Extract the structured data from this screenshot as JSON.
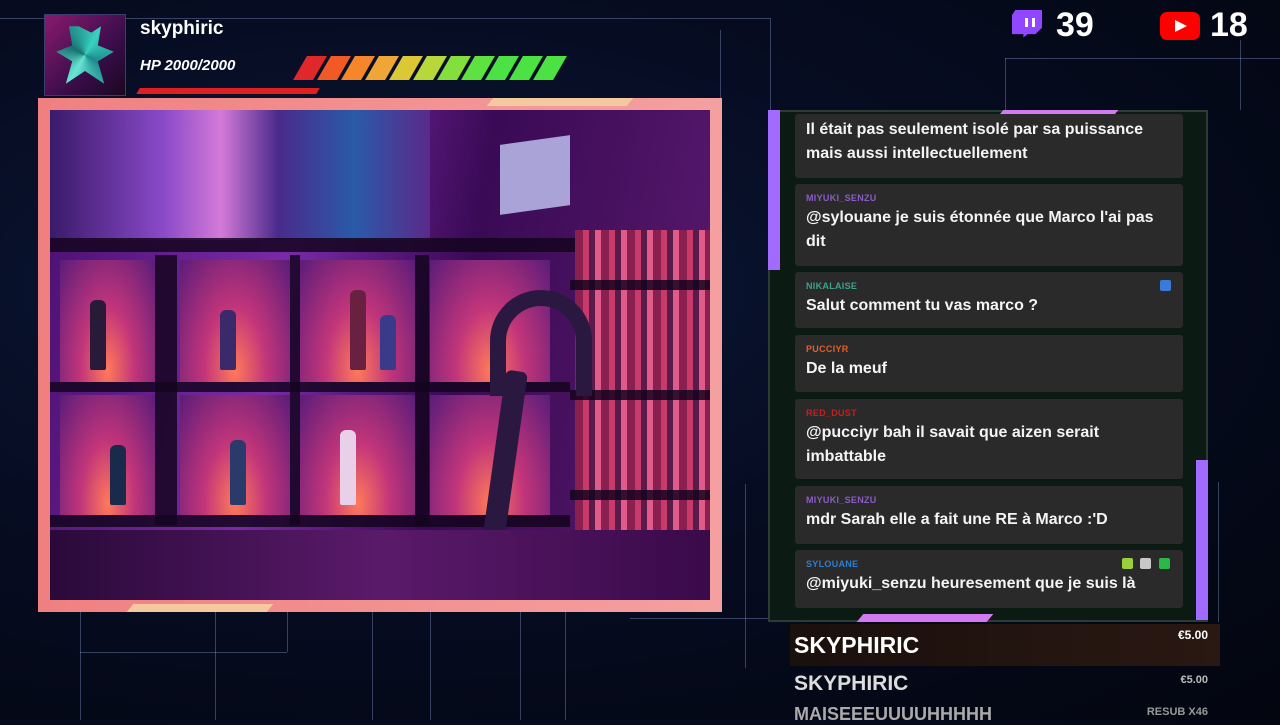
{
  "streamer": {
    "name": "skyphiric",
    "hp": "HP 2000/2000"
  },
  "counters": {
    "twitch": "39",
    "youtube": "18"
  },
  "hp_segments": [
    "#e0272a",
    "#f25a25",
    "#f5862a",
    "#f0a637",
    "#dcc835",
    "#b8d83a",
    "#84de3c",
    "#5ee23f",
    "#4ce244",
    "#4ce244",
    "#4ce244"
  ],
  "chat": [
    {
      "user": "",
      "user_color": "#9aa",
      "text": "Il était pas seulement isolé par sa puissance mais aussi intellectuellement"
    },
    {
      "user": "MIYUKI_SENZU",
      "user_color": "#8a5cc8",
      "text": "@sylouane je suis étonnée que Marco l'ai pas dit"
    },
    {
      "user": "NIKALAISE",
      "user_color": "#3ca38c",
      "text": "Salut comment tu vas marco ?"
    },
    {
      "user": "PUCCIYR",
      "user_color": "#e0602a",
      "text": "De la meuf"
    },
    {
      "user": "RED_DUST",
      "user_color": "#c81e1e",
      "text": "@pucciyr bah il savait que aizen serait imbattable"
    },
    {
      "user": "MIYUKI_SENZU",
      "user_color": "#8a5cc8",
      "text": "mdr Sarah elle a fait une RE à Marco :'D"
    },
    {
      "user": "SYLOUANE",
      "user_color": "#2a7fd0",
      "text": "@miyuki_senzu heuresement que je suis là"
    }
  ],
  "alerts": [
    {
      "name": "SKYPHIRIC",
      "amount": "€5.00"
    },
    {
      "name": "SKYPHIRIC",
      "amount": "€5.00"
    },
    {
      "name": "MAISEEEUUUUHHHHH",
      "amount": "RESUB X46"
    }
  ]
}
